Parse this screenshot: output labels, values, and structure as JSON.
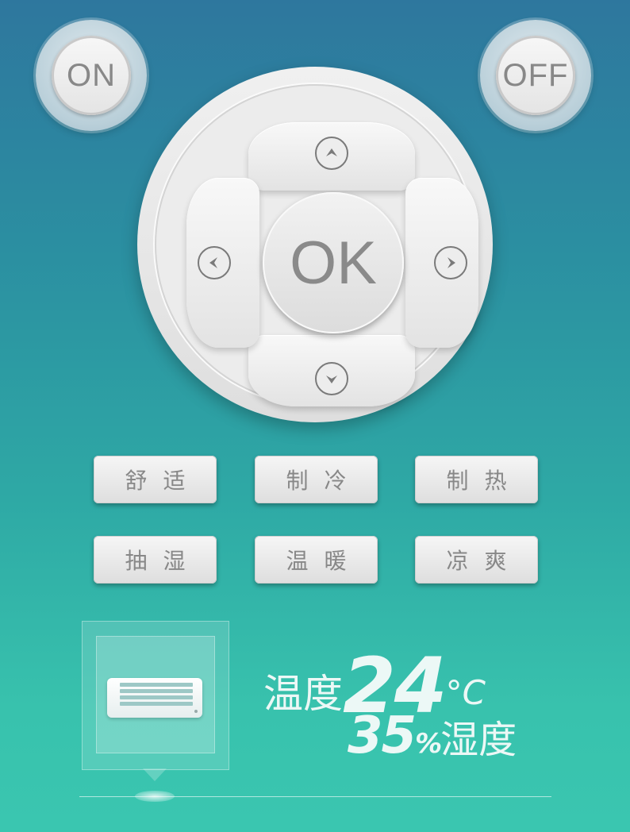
{
  "power": {
    "on_label": "ON",
    "off_label": "OFF"
  },
  "dpad": {
    "ok_label": "OK",
    "up_icon": "chevron-up-icon",
    "down_icon": "chevron-down-icon",
    "left_icon": "chevron-left-icon",
    "right_icon": "chevron-right-icon"
  },
  "modes": {
    "comfort": "舒适",
    "cool": "制冷",
    "heat": "制热",
    "dehumidify": "抽湿",
    "warm": "温暖",
    "breeze": "凉爽"
  },
  "status": {
    "device_icon": "air-conditioner-icon",
    "temp_label": "温度",
    "temp_value": "24",
    "temp_unit": "°C",
    "humidity_value": "35",
    "humidity_unit": "%",
    "humidity_label": "湿度"
  },
  "colors": {
    "bg_top": "#2e779e",
    "bg_bottom": "#3ac6b0",
    "button_text": "#888888"
  }
}
